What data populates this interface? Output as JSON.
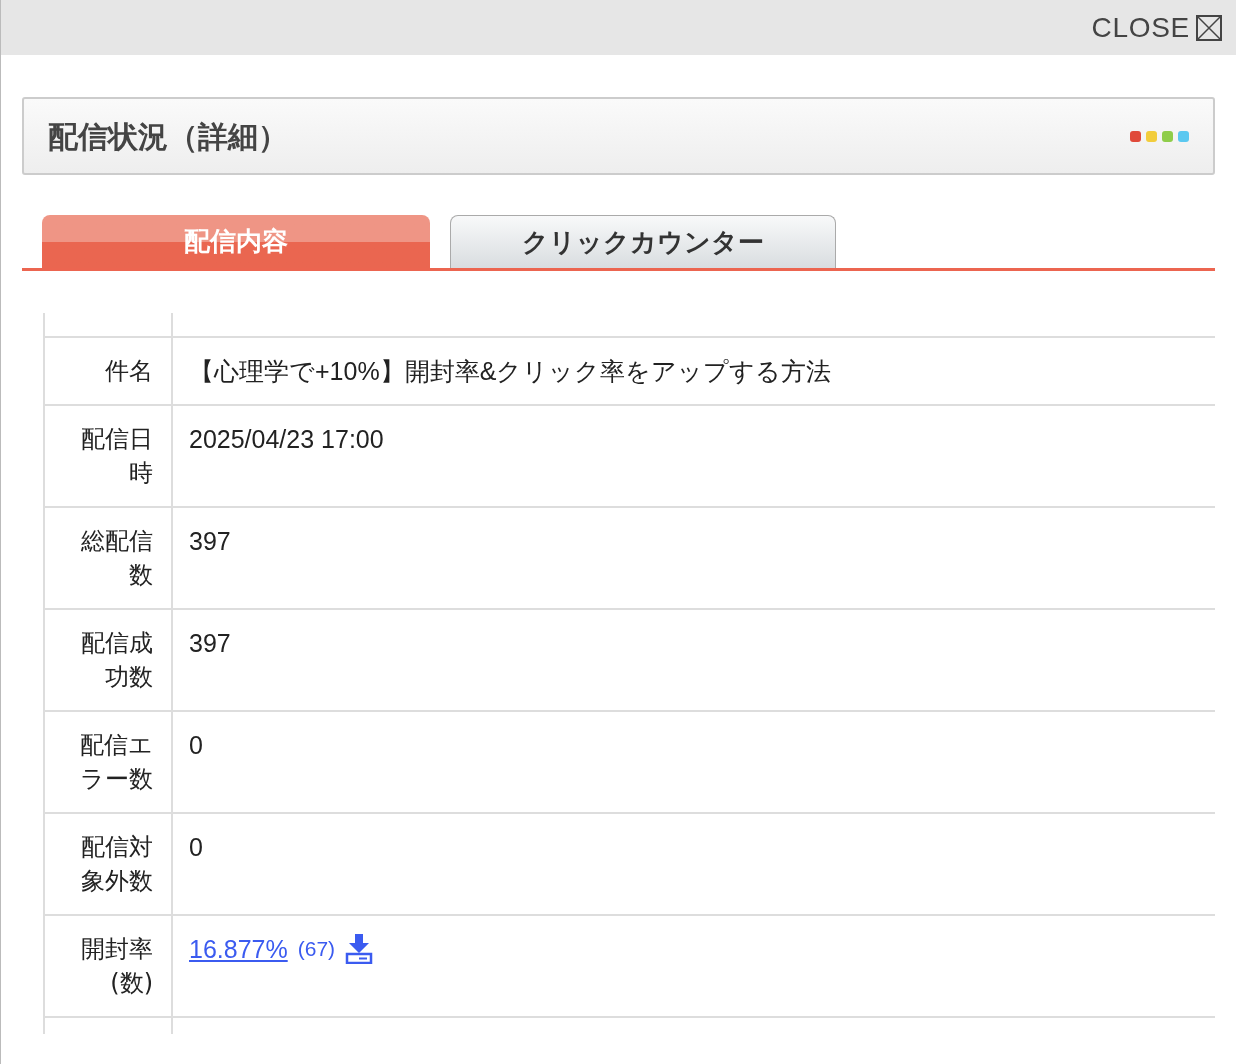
{
  "close_button": {
    "label": "CLOSE"
  },
  "panel": {
    "title": "配信状況（詳細）",
    "dots": [
      {
        "color": "#e04a3a"
      },
      {
        "color": "#f2cd3c"
      },
      {
        "color": "#8fcd4a"
      },
      {
        "color": "#5bc8f0"
      }
    ]
  },
  "tabs": [
    {
      "label": "配信内容",
      "selected": true
    },
    {
      "label": "クリックカウンター",
      "selected": false
    }
  ],
  "rows": [
    {
      "label": "件名",
      "value": "【心理学で+10%】開封率&クリック率をアップする方法"
    },
    {
      "label": "配信日時",
      "value": "2025/04/23 17:00"
    },
    {
      "label": "総配信数",
      "value": "397"
    },
    {
      "label": "配信成功数",
      "value": "397"
    },
    {
      "label": "配信エラー数",
      "value": "0"
    },
    {
      "label": "配信対象外数",
      "value": "0"
    },
    {
      "label": "開封率 (数)",
      "link": "16.877%",
      "count": "(67)",
      "download": true
    }
  ]
}
